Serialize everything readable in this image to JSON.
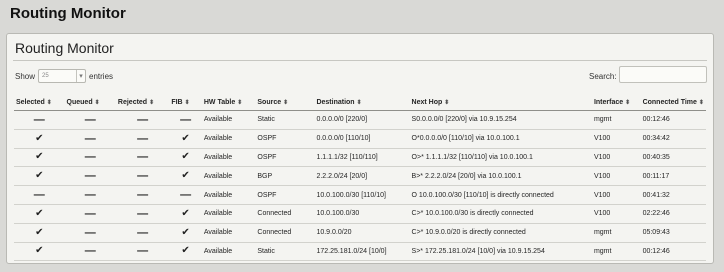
{
  "page": {
    "title": "Routing Monitor"
  },
  "panel": {
    "title": "Routing Monitor",
    "show_label": "Show",
    "entries_value": "25",
    "entries_label": "entries",
    "search_label": "Search:",
    "search_value": ""
  },
  "table": {
    "columns": [
      {
        "label": "Selected",
        "align": "center"
      },
      {
        "label": "Queued",
        "align": "center"
      },
      {
        "label": "Rejected",
        "align": "center"
      },
      {
        "label": "FIB",
        "align": "center"
      },
      {
        "label": "HW Table",
        "align": "left"
      },
      {
        "label": "Source",
        "align": "left"
      },
      {
        "label": "Destination",
        "align": "left"
      },
      {
        "label": "Next Hop",
        "align": "left"
      },
      {
        "label": "Interface",
        "align": "left"
      },
      {
        "label": "Connected Time",
        "align": "left"
      }
    ],
    "rows": [
      {
        "selected": "dash",
        "queued": "dash",
        "rejected": "dash",
        "fib": "dash",
        "hw_table": "Available",
        "source": "Static",
        "destination": "0.0.0.0/0 [220/0]",
        "next_hop": "S0.0.0.0/0 [220/0] via 10.9.15.254",
        "interface": "mgmt",
        "connected_time": "00:12:46"
      },
      {
        "selected": "check",
        "queued": "dash",
        "rejected": "dash",
        "fib": "check",
        "hw_table": "Available",
        "source": "OSPF",
        "destination": "0.0.0.0/0 [110/10]",
        "next_hop": "O*0.0.0.0/0 [110/10] via 10.0.100.1",
        "interface": "V100",
        "connected_time": "00:34:42"
      },
      {
        "selected": "check",
        "queued": "dash",
        "rejected": "dash",
        "fib": "check",
        "hw_table": "Available",
        "source": "OSPF",
        "destination": "1.1.1.1/32 [110/110]",
        "next_hop": "O>* 1.1.1.1/32 [110/110] via 10.0.100.1",
        "interface": "V100",
        "connected_time": "00:40:35"
      },
      {
        "selected": "check",
        "queued": "dash",
        "rejected": "dash",
        "fib": "check",
        "hw_table": "Available",
        "source": "BGP",
        "destination": "2.2.2.0/24 [20/0]",
        "next_hop": "B>* 2.2.2.0/24 [20/0] via 10.0.100.1",
        "interface": "V100",
        "connected_time": "00:11:17"
      },
      {
        "selected": "dash",
        "queued": "dash",
        "rejected": "dash",
        "fib": "dash",
        "hw_table": "Available",
        "source": "OSPF",
        "destination": "10.0.100.0/30 [110/10]",
        "next_hop": "O 10.0.100.0/30 [110/10] is directly connected",
        "interface": "V100",
        "connected_time": "00:41:32"
      },
      {
        "selected": "check",
        "queued": "dash",
        "rejected": "dash",
        "fib": "check",
        "hw_table": "Available",
        "source": "Connected",
        "destination": "10.0.100.0/30",
        "next_hop": "C>* 10.0.100.0/30 is directly connected",
        "interface": "V100",
        "connected_time": "02:22:46"
      },
      {
        "selected": "check",
        "queued": "dash",
        "rejected": "dash",
        "fib": "check",
        "hw_table": "Available",
        "source": "Connected",
        "destination": "10.9.0.0/20",
        "next_hop": "C>* 10.9.0.0/20 is directly connected",
        "interface": "mgmt",
        "connected_time": "05:09:43"
      },
      {
        "selected": "check",
        "queued": "dash",
        "rejected": "dash",
        "fib": "check",
        "hw_table": "Available",
        "source": "Static",
        "destination": "172.25.181.0/24 [10/0]",
        "next_hop": "S>* 172.25.181.0/24 [10/0] via 10.9.15.254",
        "interface": "mgmt",
        "connected_time": "00:12:46"
      }
    ]
  },
  "icons": {
    "check": "✔",
    "dash": "—",
    "sort": "⬍",
    "caret": "▾"
  }
}
